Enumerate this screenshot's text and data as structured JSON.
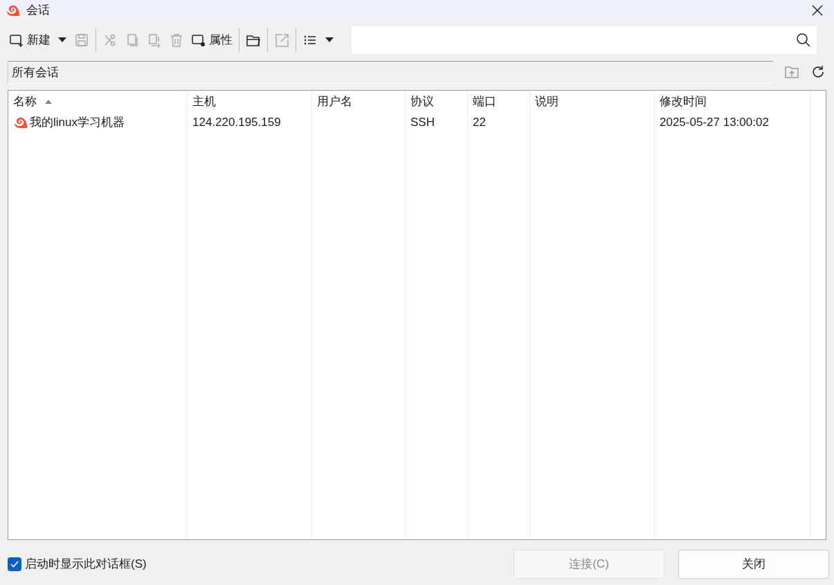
{
  "window": {
    "title": "会话"
  },
  "toolbar": [
    {
      "kind": "button",
      "label": "新建",
      "disabled": false
    },
    {
      "kind": "dropdown",
      "disabled": false
    },
    {
      "kind": "button",
      "disabled": true
    },
    {
      "kind": "separator"
    },
    {
      "kind": "button",
      "disabled": true
    },
    {
      "kind": "button",
      "disabled": true
    },
    {
      "kind": "button",
      "disabled": true
    },
    {
      "kind": "button",
      "disabled": true
    },
    {
      "kind": "button",
      "label": "属性",
      "disabled": false
    },
    {
      "kind": "separator"
    },
    {
      "kind": "button",
      "disabled": false
    },
    {
      "kind": "separator"
    },
    {
      "kind": "button",
      "disabled": true
    },
    {
      "kind": "separator"
    },
    {
      "kind": "button",
      "disabled": false
    },
    {
      "kind": "dropdown",
      "disabled": false
    }
  ],
  "path": {
    "value": "所有会话"
  },
  "table": {
    "columns": [
      {
        "label": "名称",
        "sorted": true
      },
      {
        "label": "主机",
        "sorted": false
      },
      {
        "label": "用户名",
        "sorted": false
      },
      {
        "label": "协议",
        "sorted": false
      },
      {
        "label": "端口",
        "sorted": false
      },
      {
        "label": "说明",
        "sorted": false
      },
      {
        "label": "修改时间",
        "sorted": false
      }
    ],
    "rows": [
      {
        "selected": false,
        "cells": [
          "我的linux学习机器",
          "124.220.195.159",
          null,
          "SSH",
          "22",
          null,
          "2025-05-27 13:00:02"
        ]
      }
    ]
  },
  "startup_checkbox": {
    "label": "启动时显示此对话框(S)",
    "checked": true
  },
  "buttons": [
    {
      "label": "连接(C)",
      "disabled": true
    },
    {
      "label": "关闭",
      "disabled": false
    }
  ]
}
